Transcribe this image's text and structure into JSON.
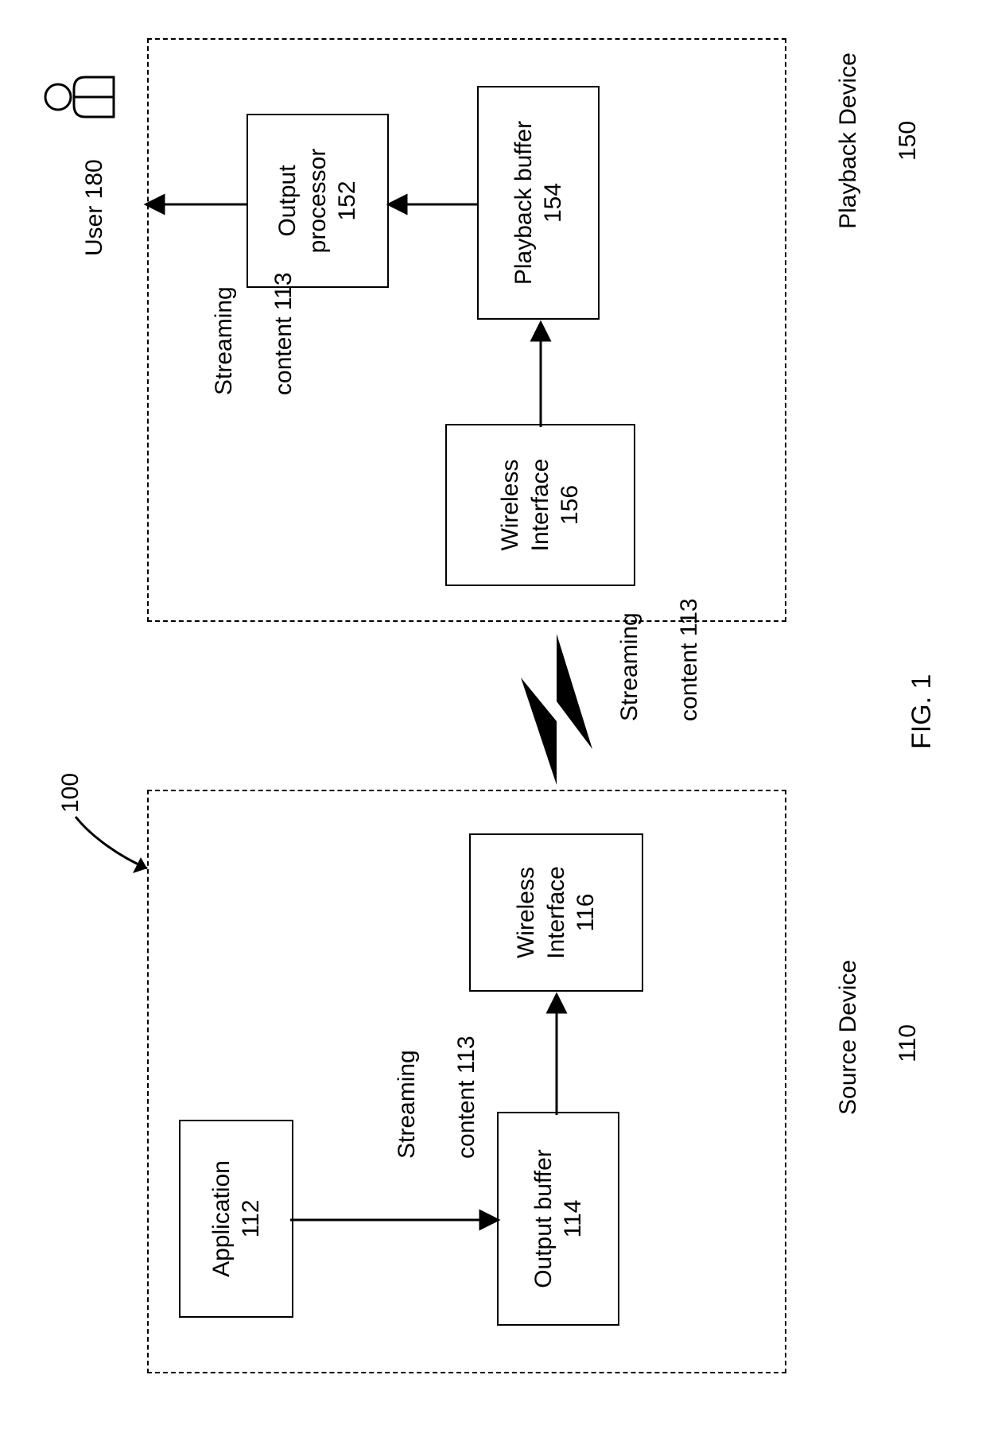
{
  "figure_ref": "100",
  "figure_caption": "FIG. 1",
  "diagram_type": "block_diagram",
  "source_device": {
    "label": "Source Device",
    "ref": "110",
    "blocks": {
      "application": {
        "label": "Application",
        "ref": "112"
      },
      "output_buffer": {
        "label": "Output buffer",
        "ref": "114"
      },
      "wireless_interface": {
        "label": "Wireless\nInterface",
        "ref": "116"
      }
    },
    "internal_streaming_label": {
      "label": "Streaming",
      "sublabel": "content 113"
    }
  },
  "wireless_link_label": {
    "label": "Streaming",
    "sublabel": "content 113"
  },
  "playback_device": {
    "label": "Playback Device",
    "ref": "150",
    "blocks": {
      "wireless_interface": {
        "label": "Wireless\nInterface",
        "ref": "156"
      },
      "playback_buffer": {
        "label": "Playback buffer",
        "ref": "154"
      },
      "output_processor": {
        "label": "Output\nprocessor",
        "ref": "152"
      }
    },
    "output_streaming_label": {
      "label": "Streaming",
      "sublabel": "content 113"
    }
  },
  "user": {
    "label": "User 180"
  },
  "connections": [
    {
      "from": "source_device.application",
      "to": "source_device.output_buffer"
    },
    {
      "from": "source_device.output_buffer",
      "to": "source_device.wireless_interface"
    },
    {
      "from": "source_device.wireless_interface",
      "to": "playback_device.wireless_interface",
      "via": "wireless"
    },
    {
      "from": "playback_device.wireless_interface",
      "to": "playback_device.playback_buffer"
    },
    {
      "from": "playback_device.playback_buffer",
      "to": "playback_device.output_processor"
    },
    {
      "from": "playback_device.output_processor",
      "to": "user"
    }
  ]
}
